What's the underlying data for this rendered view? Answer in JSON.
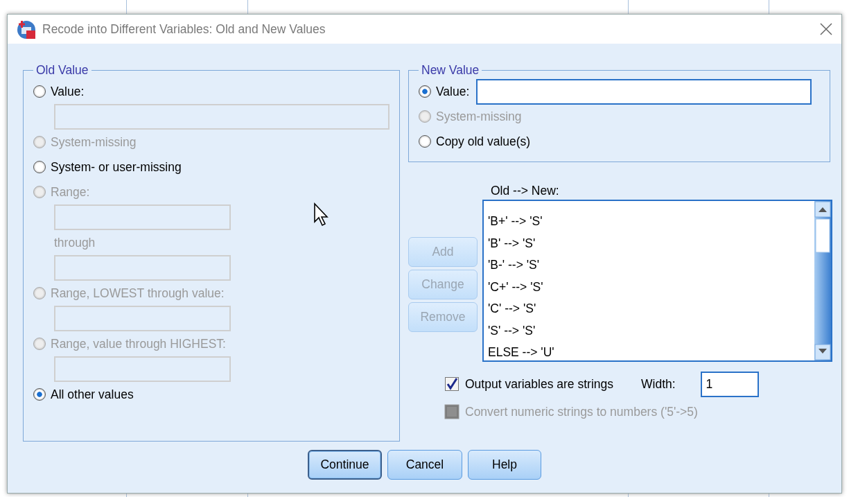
{
  "window": {
    "title": "Recode into Different Variables: Old and New Values"
  },
  "old_value": {
    "legend": "Old Value",
    "options": [
      {
        "kind": "radio",
        "label": "Value:",
        "selected": false,
        "disabled": false
      },
      {
        "kind": "wide_field",
        "disabled": true
      },
      {
        "kind": "radio",
        "label": "System-missing",
        "selected": false,
        "disabled": true
      },
      {
        "kind": "radio",
        "label": "System- or user-missing",
        "selected": false,
        "disabled": false
      },
      {
        "kind": "radio",
        "label": "Range:",
        "selected": false,
        "disabled": true
      },
      {
        "kind": "field",
        "disabled": true
      },
      {
        "kind": "note",
        "label": "through",
        "disabled": true
      },
      {
        "kind": "field",
        "disabled": true
      },
      {
        "kind": "radio",
        "label": "Range, LOWEST through value:",
        "selected": false,
        "disabled": true
      },
      {
        "kind": "field",
        "disabled": true
      },
      {
        "kind": "radio",
        "label": "Range, value through HIGHEST:",
        "selected": false,
        "disabled": true
      },
      {
        "kind": "field",
        "disabled": true
      },
      {
        "kind": "radio",
        "label": "All other values",
        "selected": true,
        "disabled": false
      }
    ]
  },
  "new_value": {
    "legend": "New Value",
    "options": [
      {
        "kind": "radio_field",
        "label": "Value:",
        "selected": true,
        "disabled": false
      },
      {
        "kind": "radio",
        "label": "System-missing",
        "selected": false,
        "disabled": true
      },
      {
        "kind": "radio",
        "label": "Copy old value(s)",
        "selected": false,
        "disabled": false
      }
    ]
  },
  "buttons": [
    {
      "label": "Add",
      "disabled": true
    },
    {
      "label": "Change",
      "disabled": true
    },
    {
      "label": "Remove",
      "disabled": true
    }
  ],
  "mappings": {
    "label": "Old --> New:",
    "items": [
      "'B+' --> 'S'",
      "'B' --> 'S'",
      "'B-' --> 'S'",
      "'C+' --> 'S'",
      "'C' --> 'S'",
      "'S' --> 'S'",
      "ELSE --> 'U'"
    ]
  },
  "options": [
    {
      "label": "Output variables are strings",
      "checked": true,
      "disabled": false
    },
    {
      "label": "Convert numeric strings to numbers ('5'->5)",
      "checked": false,
      "disabled": true
    }
  ],
  "width": {
    "label": "Width:",
    "value": "1"
  },
  "footer": [
    {
      "label": "Continue",
      "default": true
    },
    {
      "label": "Cancel",
      "default": false
    },
    {
      "label": "Help",
      "default": false
    }
  ]
}
